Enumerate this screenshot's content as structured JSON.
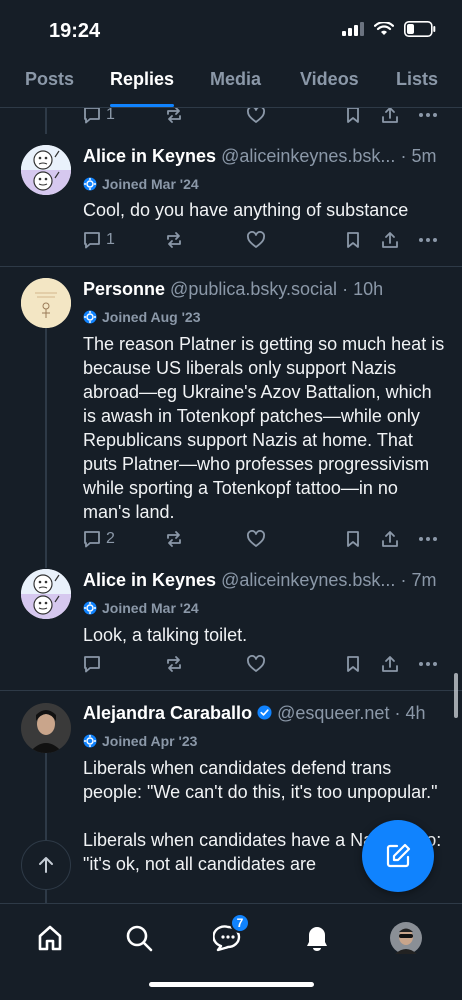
{
  "status_bar": {
    "time": "19:24"
  },
  "tabs": [
    {
      "label": "Posts"
    },
    {
      "label": "Replies"
    },
    {
      "label": "Media"
    },
    {
      "label": "Videos"
    },
    {
      "label": "Lists"
    }
  ],
  "top_actions": {
    "reply_count": "1"
  },
  "posts": [
    {
      "name": "Alice in Keynes",
      "handle": "@aliceinkeynes.bsk...",
      "time": "· 5m",
      "joined": "Joined Mar '24",
      "text": "Cool, do you have anything of substance",
      "reply_count": "1"
    },
    {
      "name": "Personne",
      "handle": "@publica.bsky.social",
      "time": "· 10h",
      "joined": "Joined Aug '23",
      "text": "The reason Platner is getting so much heat is because US liberals only support Nazis abroad—eg Ukraine's Azov Battalion, which is awash in Totenkopf patches—while only Republicans support Nazis at home. That puts Platner—who professes progressivism while sporting a Totenkopf tattoo—in no man's land.",
      "reply_count": "2"
    },
    {
      "name": "Alice in Keynes",
      "handle": "@aliceinkeynes.bsk...",
      "time": "· 7m",
      "joined": "Joined Mar '24",
      "text": "Look, a talking toilet.",
      "reply_count": ""
    },
    {
      "name": "Alejandra Caraballo",
      "handle": "@esqueer.net",
      "time": "· 4h",
      "joined": "Joined Apr '23",
      "text": "Liberals when candidates defend trans people: \"We can't do this, it's too unpopular.\"\n\nLiberals when candidates have a Nazi tattoo: \"it's ok, not all candidates are"
    }
  ],
  "bottom_nav": {
    "chat_badge": "7"
  },
  "colors": {
    "background": "#161e27",
    "accent": "#1083fe",
    "muted": "#8b98a8",
    "divider": "#2e3a47"
  },
  "icons": [
    "home-icon",
    "search-icon",
    "chat-icon",
    "bell-icon",
    "compose-icon",
    "arrow-up-icon",
    "reply-icon",
    "repost-icon",
    "like-icon",
    "bookmark-icon",
    "share-icon",
    "more-icon",
    "verified-icon",
    "new-user-icon"
  ]
}
